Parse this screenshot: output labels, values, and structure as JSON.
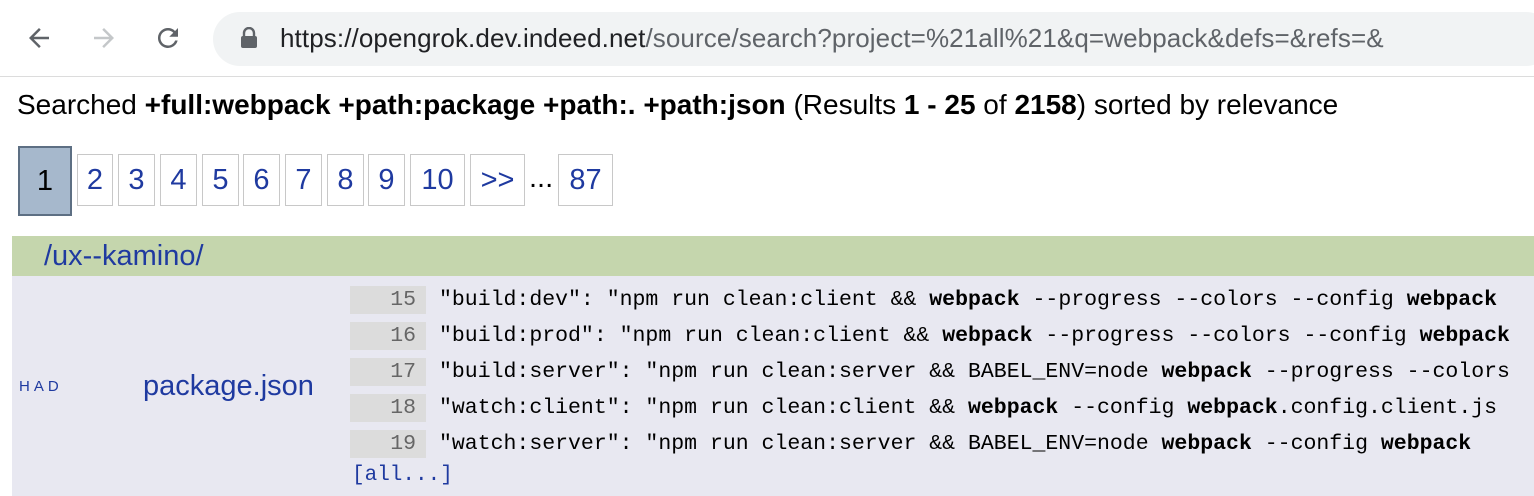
{
  "browser": {
    "url_host": "https://opengrok.dev.indeed.net",
    "url_rest": "/source/search?project=%21all%21&q=webpack&defs=&refs=&"
  },
  "summary": {
    "prefix": "Searched ",
    "query": "+full:webpack +path:package +path:. +path:json",
    "results_open": " (Results ",
    "range": "1 - 25",
    "of": " of ",
    "total": "2158",
    "suffix": ") sorted by relevance"
  },
  "pager": {
    "current": "1",
    "pages": [
      "2",
      "3",
      "4",
      "5",
      "6",
      "7",
      "8",
      "9",
      "10"
    ],
    "next": ">>",
    "ellipsis": "...",
    "last": "87"
  },
  "results": {
    "directory": "/ux--kamino/",
    "file": {
      "tags": "HAD",
      "name": "package.json",
      "lines": [
        {
          "num": "15",
          "segments": [
            {
              "t": "\"build:dev\": \"npm run clean:client && ",
              "b": false
            },
            {
              "t": "webpack",
              "b": true
            },
            {
              "t": " --progress --colors --config ",
              "b": false
            },
            {
              "t": "webpack",
              "b": true
            }
          ]
        },
        {
          "num": "16",
          "segments": [
            {
              "t": "\"build:prod\": \"npm run clean:client && ",
              "b": false
            },
            {
              "t": "webpack",
              "b": true
            },
            {
              "t": " --progress --colors --config ",
              "b": false
            },
            {
              "t": "webpack",
              "b": true
            }
          ]
        },
        {
          "num": "17",
          "segments": [
            {
              "t": "\"build:server\": \"npm run clean:server && BABEL_ENV=node ",
              "b": false
            },
            {
              "t": "webpack",
              "b": true
            },
            {
              "t": " --progress --colors",
              "b": false
            }
          ]
        },
        {
          "num": "18",
          "segments": [
            {
              "t": "\"watch:client\": \"npm run clean:client && ",
              "b": false
            },
            {
              "t": "webpack",
              "b": true
            },
            {
              "t": " --config ",
              "b": false
            },
            {
              "t": "webpack",
              "b": true
            },
            {
              "t": ".config.client.js",
              "b": false
            }
          ]
        },
        {
          "num": "19",
          "segments": [
            {
              "t": "\"watch:server\": \"npm run clean:server && BABEL_ENV=node ",
              "b": false
            },
            {
              "t": "webpack",
              "b": true
            },
            {
              "t": " --config ",
              "b": false
            },
            {
              "t": "webpack",
              "b": true
            }
          ]
        }
      ],
      "all_link": "[all...]"
    }
  },
  "colors": {
    "link": "#1f3aa0",
    "dir_bar": "#c5d6ad",
    "result_bg": "#e8e8f1",
    "current_page": "#a6b8cc"
  }
}
